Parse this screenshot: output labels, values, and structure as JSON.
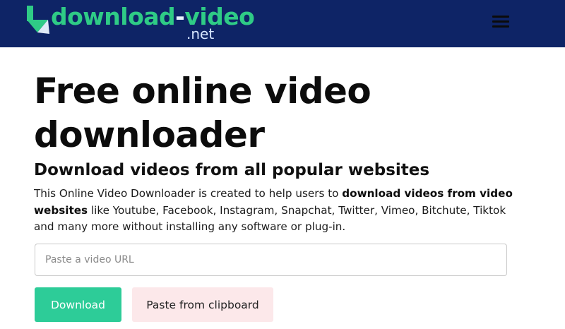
{
  "header": {
    "logo": {
      "word_start": "download",
      "hyphen": "-",
      "word_end": "video",
      "suffix": ".net",
      "icon": "download-arrow-icon"
    },
    "menu_icon": "hamburger-menu-icon",
    "background": "#0e2466"
  },
  "main": {
    "title": "Free online video downloader",
    "subtitle": "Download videos from all popular websites",
    "intro": {
      "part1": "This Online Video Downloader is created to help users to ",
      "bold": "download videos from video websites",
      "part2": " like Youtube, Facebook, Instagram, Snapchat, Twitter, Vimeo, Bitchute, Tiktok and many more without installing any software or plug-in."
    },
    "url_input": {
      "placeholder": "Paste a video URL",
      "value": ""
    },
    "download_button": "Download",
    "paste_button": "Paste from clipboard"
  },
  "colors": {
    "accent_green": "#2dcc98",
    "paste_bg": "#fce8ea"
  }
}
